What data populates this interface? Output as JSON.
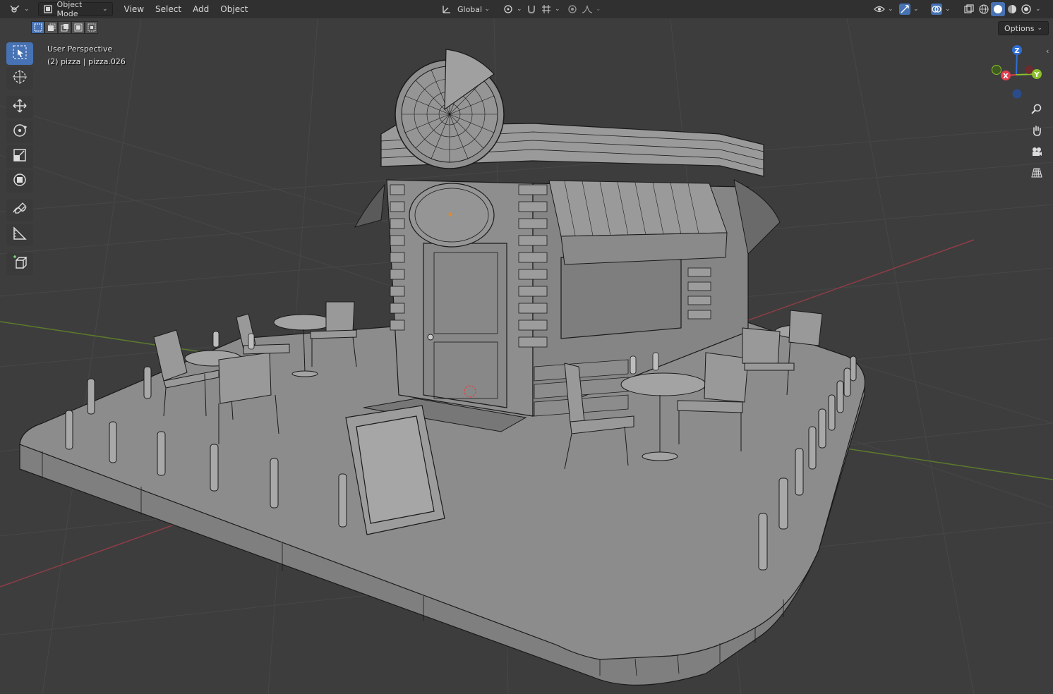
{
  "header": {
    "editor_type_icon": "3d-viewport-icon",
    "mode_label": "Object Mode",
    "menus": [
      "View",
      "Select",
      "Add",
      "Object"
    ],
    "transform_orientation": "Global",
    "options_label": "Options"
  },
  "viewport": {
    "view_name": "User Perspective",
    "active_object": "(2) pizza | pizza.026"
  },
  "gizmo": {
    "axis_z": "Z",
    "axis_x": "X",
    "axis_y": "Y"
  },
  "colors": {
    "accent": "#4772b3",
    "x_axis": "#e0404f",
    "y_axis": "#8bbf2b",
    "z_axis": "#2f6fd6",
    "grid": "#474747",
    "mesh": "#8a8a8a",
    "wire": "#1a1a1a"
  }
}
